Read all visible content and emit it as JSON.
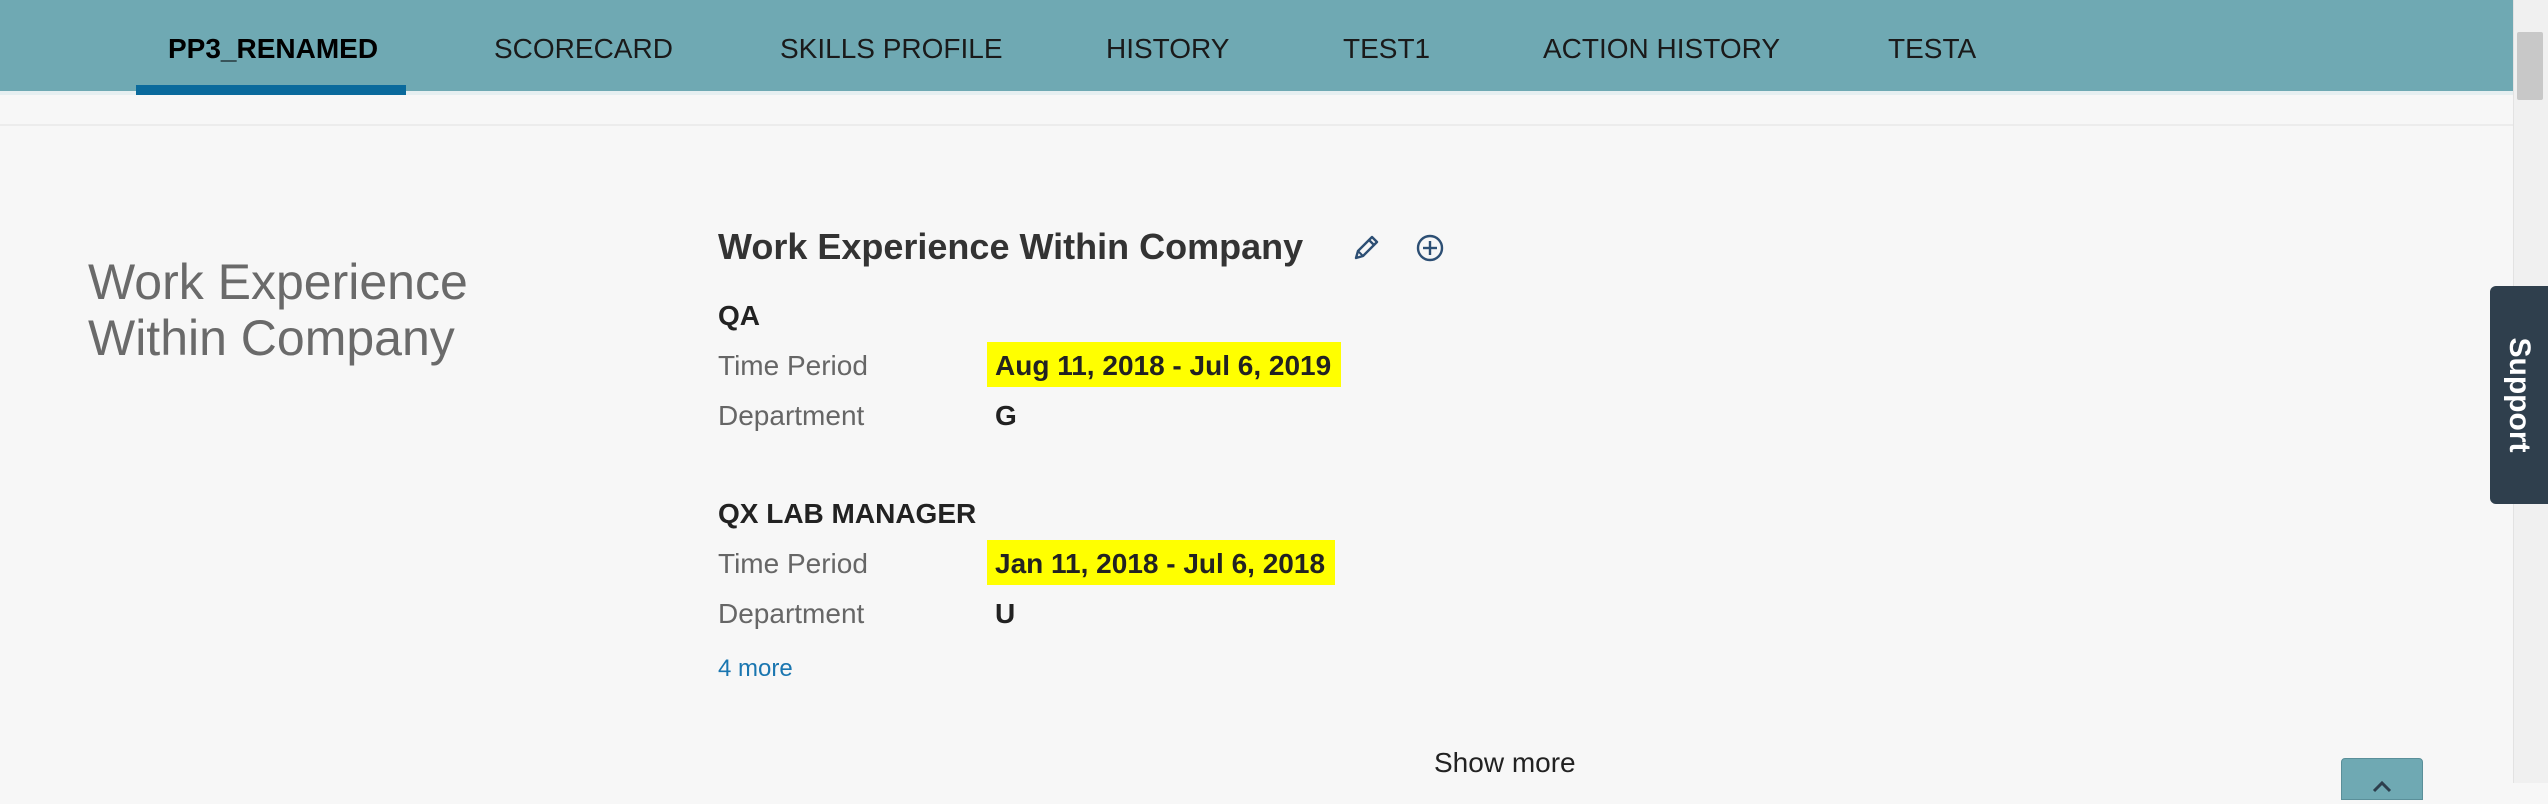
{
  "tabs": [
    {
      "label": "PP3_RENAMED",
      "active": true
    },
    {
      "label": "SCORECARD"
    },
    {
      "label": "SKILLS PROFILE"
    },
    {
      "label": "HISTORY"
    },
    {
      "label": "TEST1"
    },
    {
      "label": "ACTION HISTORY"
    },
    {
      "label": "TESTA"
    }
  ],
  "section": {
    "title": "Work Experience Within Company",
    "card_title": "Work Experience Within Company",
    "entries": [
      {
        "title": "QA",
        "time_period_label": "Time Period",
        "time_period": "Aug 11, 2018 - Jul 6, 2019",
        "department_label": "Department",
        "department": "G"
      },
      {
        "title": "QX LAB MANAGER",
        "time_period_label": "Time Period",
        "time_period": "Jan 11, 2018 - Jul 6, 2018",
        "department_label": "Department",
        "department": "U"
      }
    ],
    "more_link": "4 more",
    "show_more": "Show more"
  },
  "support": {
    "label": "Support"
  },
  "icons": {
    "edit": "pencil-icon",
    "add": "plus-circle-icon",
    "to_top": "chevron-up-icon"
  },
  "colors": {
    "tabbar": "#6fa9b3",
    "indicator": "#0a6a9c",
    "highlight": "#ffff00",
    "link": "#1a76b0",
    "support_bg": "#2f3f4d"
  }
}
